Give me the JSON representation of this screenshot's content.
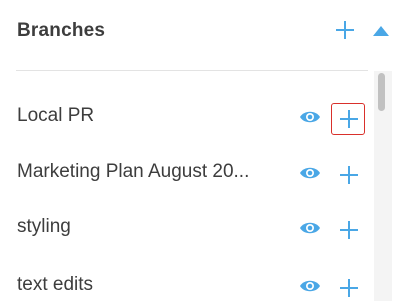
{
  "panel": {
    "title": "Branches"
  },
  "header": {
    "add_icon": "plus-icon",
    "collapse_icon": "triangle-up-icon"
  },
  "branches": [
    {
      "label": "Local PR"
    },
    {
      "label": "Marketing Plan August 20..."
    },
    {
      "label": "styling"
    },
    {
      "label": "text edits"
    }
  ],
  "colors": {
    "accent": "#4aa7e6",
    "highlight": "#d9302b",
    "text": "#3d3d3d"
  }
}
